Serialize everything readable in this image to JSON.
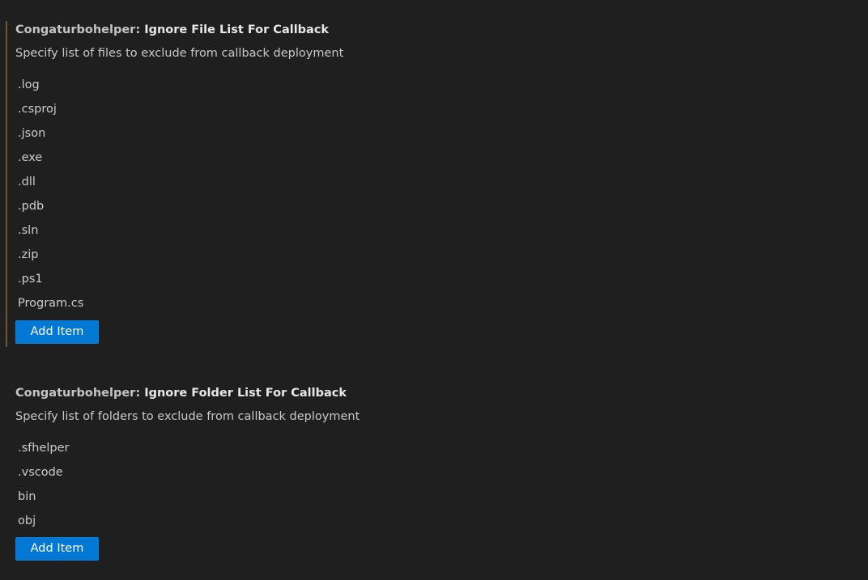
{
  "settings": [
    {
      "category": "Congaturbohelper: ",
      "label": "Ignore File List For Callback",
      "description": "Specify list of files to exclude from callback deployment",
      "items": [
        ".log",
        ".csproj",
        ".json",
        ".exe",
        ".dll",
        ".pdb",
        ".sln",
        ".zip",
        ".ps1",
        "Program.cs"
      ],
      "add_button_label": "Add Item"
    },
    {
      "category": "Congaturbohelper: ",
      "label": "Ignore Folder List For Callback",
      "description": "Specify list of folders to exclude from callback deployment",
      "items": [
        ".sfhelper",
        ".vscode",
        "bin",
        "obj"
      ],
      "add_button_label": "Add Item"
    }
  ],
  "colors": {
    "background": "#1f1f1f",
    "button": "#0078d4",
    "modified_indicator": "#6b5a2c"
  }
}
